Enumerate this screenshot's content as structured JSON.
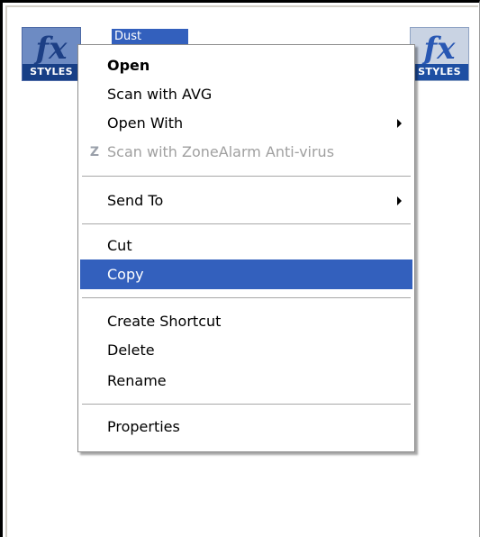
{
  "desktop": {
    "icon_left": {
      "glyph": "fx",
      "caption": "STYLES",
      "selected": true
    },
    "icon_right": {
      "glyph": "fx",
      "caption": "STYLES",
      "selected": false
    },
    "selected_label": "Dust"
  },
  "menu": {
    "items": [
      {
        "label": "Open"
      },
      {
        "label": "Scan with AVG"
      },
      {
        "label": "Open With",
        "icon": "arrow-right-icon"
      },
      {
        "label": "Scan with ZoneAlarm Anti-virus",
        "icon": "zonealarm-icon",
        "icon_glyph": "Z"
      },
      {
        "label": "Send To",
        "icon": "arrow-right-icon"
      },
      {
        "label": "Cut"
      },
      {
        "label": "Copy"
      },
      {
        "label": "Create Shortcut"
      },
      {
        "label": "Delete"
      },
      {
        "label": "Rename"
      },
      {
        "label": "Properties"
      }
    ]
  },
  "colors": {
    "highlight": "#3360bd",
    "disabled_text": "#a0a0a0",
    "menu_background": "#ffffff"
  }
}
